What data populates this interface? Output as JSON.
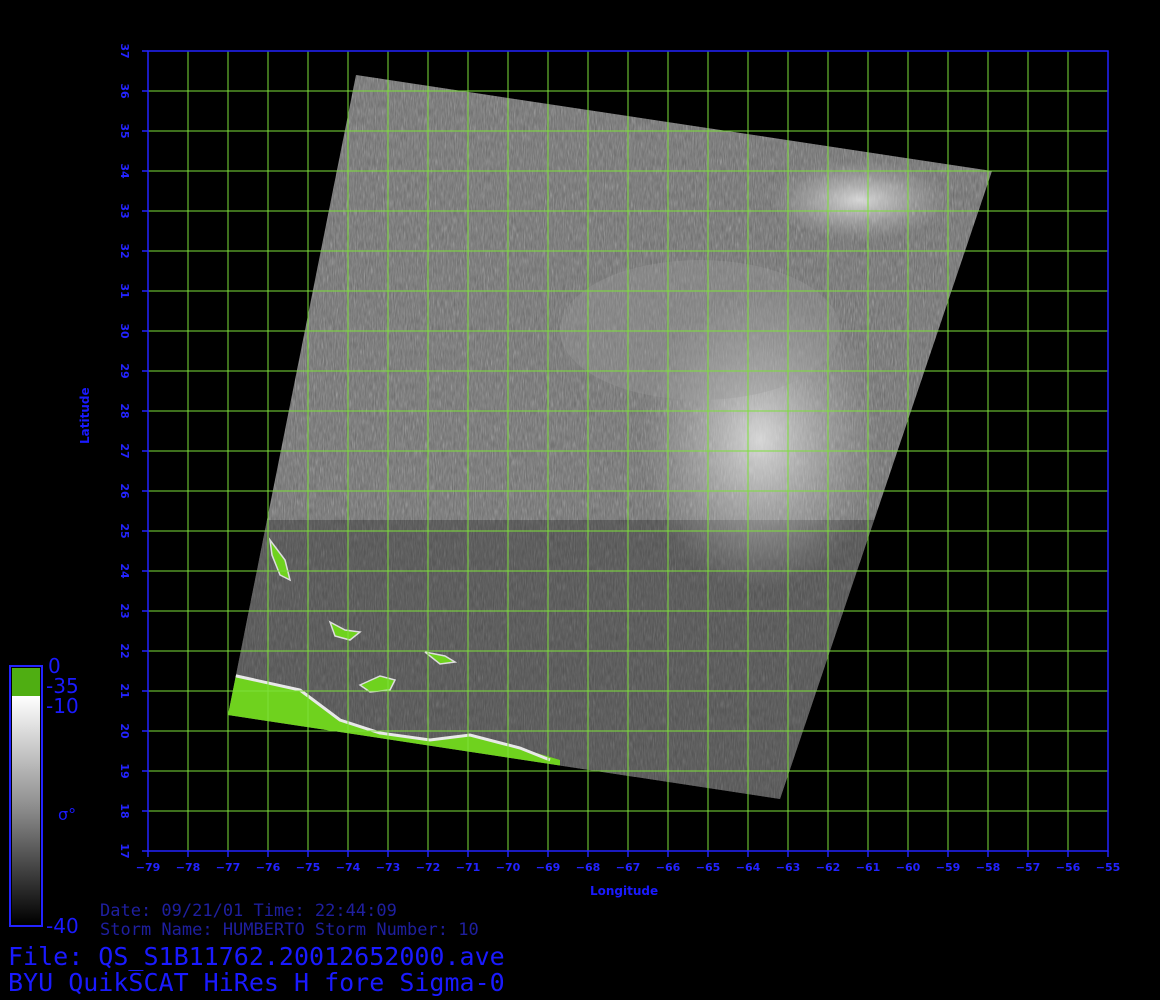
{
  "plot": {
    "lon_ticks": [
      "-79",
      "-78",
      "-77",
      "-76",
      "-75",
      "-74",
      "-73",
      "-72",
      "-71",
      "-70",
      "-69",
      "-68",
      "-67",
      "-66",
      "-65",
      "-64",
      "-63",
      "-62",
      "-61",
      "-60",
      "-59",
      "-58",
      "-57",
      "-56",
      "-55"
    ],
    "lat_ticks": [
      "17",
      "18",
      "19",
      "20",
      "21",
      "22",
      "23",
      "24",
      "25",
      "26",
      "27",
      "28",
      "29",
      "30",
      "31",
      "32",
      "33",
      "34",
      "35",
      "36",
      "37"
    ],
    "lon_range": [
      -79,
      -55
    ],
    "lat_range": [
      17,
      37
    ],
    "xlabel": "Longitude",
    "ylabel": "Latitude",
    "grid": true,
    "colors": {
      "axis": "#2323ff",
      "grid": "#7de03a",
      "land": "#6fd21e"
    },
    "swath_corners_lonlat": [
      [
        -73.8,
        36.4
      ],
      [
        -57.9,
        34.0
      ],
      [
        -63.2,
        18.3
      ],
      [
        -77.0,
        20.4
      ]
    ]
  },
  "colorbar": {
    "labels": [
      "0",
      "-35",
      "-10",
      "σ°",
      "-40"
    ]
  },
  "info": {
    "date_line": "Date: 09/21/01   Time: 22:44:09",
    "storm_line": "Storm Name: HUMBERTO   Storm Number: 10",
    "file_line": "File: QS_S1B11762.20012652000.ave",
    "title_line": "BYU QuikSCAT HiRes H fore Sigma-0"
  }
}
